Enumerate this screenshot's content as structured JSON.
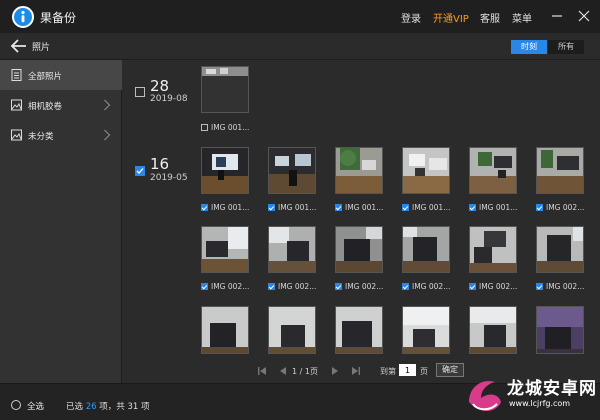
{
  "app": {
    "name": "果备份"
  },
  "topnav": {
    "login": "登录",
    "vip": "开通VIP",
    "service": "客服",
    "menu": "菜单"
  },
  "toolbar": {
    "title": "照片",
    "toggle_time": "时刻",
    "toggle_all": "所有"
  },
  "sidebar": {
    "items": [
      {
        "label": "全部照片",
        "active": true
      },
      {
        "label": "相机胶卷",
        "active": false
      },
      {
        "label": "未分类",
        "active": false
      }
    ]
  },
  "groups": [
    {
      "day": "28",
      "month": "2019-08",
      "checked": false
    },
    {
      "day": "16",
      "month": "2019-05",
      "checked": true
    }
  ],
  "photos": {
    "g1": [
      {
        "label": "IMG 001...",
        "checked": false
      }
    ],
    "row1": [
      {
        "label": "IMG 001...",
        "checked": true
      },
      {
        "label": "IMG 001...",
        "checked": true
      },
      {
        "label": "IMG 001...",
        "checked": true
      },
      {
        "label": "IMG 001...",
        "checked": true
      },
      {
        "label": "IMG 001...",
        "checked": true
      },
      {
        "label": "IMG 002...",
        "checked": true
      }
    ],
    "row2": [
      {
        "label": "IMG 002...",
        "checked": true
      },
      {
        "label": "IMG 002...",
        "checked": true
      },
      {
        "label": "IMG 002...",
        "checked": true
      },
      {
        "label": "IMG 002...",
        "checked": true
      },
      {
        "label": "IMG 002...",
        "checked": true
      },
      {
        "label": "IMG 002...",
        "checked": true
      }
    ]
  },
  "pager": {
    "page_info": "1 / 1页",
    "goto_prefix": "到第",
    "goto_value": "1",
    "goto_suffix": "页",
    "confirm": "确定"
  },
  "footer": {
    "select_all": "全选",
    "selected_prefix": "已选",
    "selected_count": "26",
    "selected_mid": "项，共",
    "total_count": "31",
    "total_suffix": "项"
  },
  "watermark": {
    "text": "龙城安卓网",
    "url": "www.lcjrfg.com"
  },
  "colors": {
    "accent": "#2a87e8",
    "vip": "#ff9b1a",
    "background": "#2b2b2b"
  }
}
